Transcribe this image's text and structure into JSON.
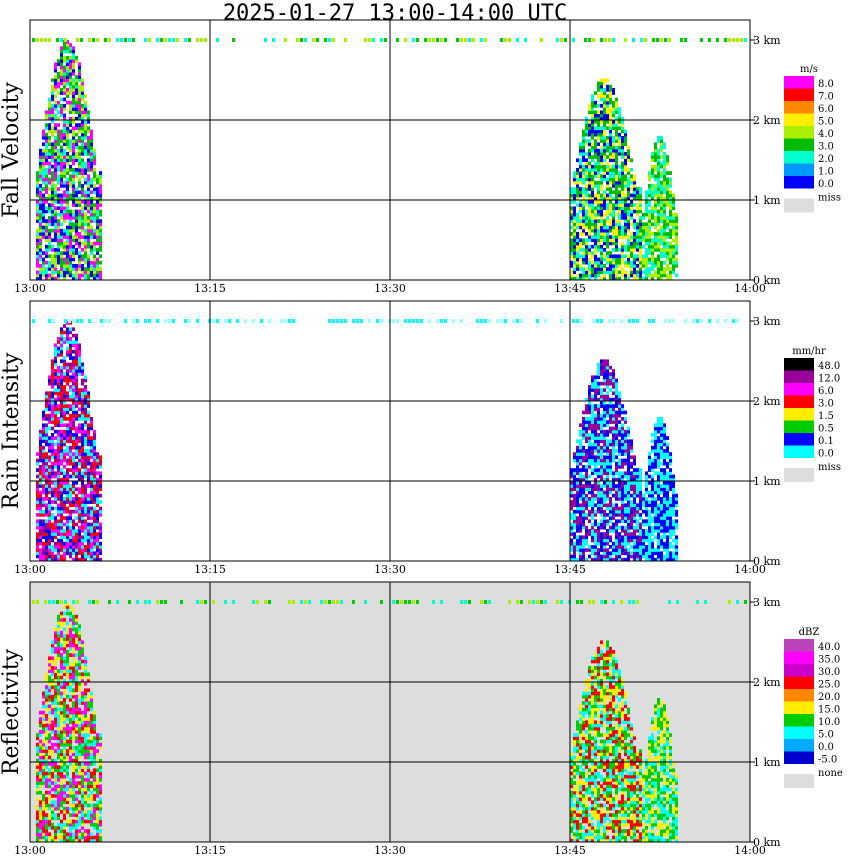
{
  "title": "2025-01-27  13:00-14:00 UTC",
  "x_ticks": [
    "13:00",
    "13:15",
    "13:30",
    "13:45",
    "14:00"
  ],
  "y_ticks": [
    "0 km",
    "1 km",
    "2 km",
    "3 km"
  ],
  "chart_data": [
    {
      "type": "heatmap",
      "ylabel": "Fall Velocity",
      "units": "m/s",
      "background": "#ffffff",
      "x_range": [
        "13:00",
        "14:00"
      ],
      "y_range_km": [
        0,
        3
      ],
      "colorbar": {
        "labels": [
          "8.0",
          "7.0",
          "6.0",
          "5.0",
          "4.0",
          "3.0",
          "2.0",
          "1.0",
          "0.0"
        ],
        "colors": [
          "#ff00ff",
          "#ff0000",
          "#ff8800",
          "#ffee00",
          "#aaee00",
          "#00bb00",
          "#00ffcc",
          "#0099ff",
          "#0000ff"
        ],
        "missing_label": "miss",
        "missing_color": "#dddddd"
      },
      "echoes": [
        {
          "t_start_min": 0.5,
          "t_end_min": 6,
          "z_top_km": 3.0,
          "colors": [
            "#00bb00",
            "#0000ff",
            "#00ffcc",
            "#ff00ff",
            "#aaee00"
          ]
        },
        {
          "t_start_min": 45,
          "t_end_min": 51,
          "z_top_km": 2.5,
          "colors": [
            "#00bb00",
            "#0000ff",
            "#ffee00",
            "#00ffcc"
          ]
        },
        {
          "t_start_min": 51,
          "t_end_min": 54,
          "z_top_km": 1.8,
          "colors": [
            "#00bb00",
            "#00ffcc",
            "#aaee00"
          ]
        }
      ]
    },
    {
      "type": "heatmap",
      "ylabel": "Rain Intensity",
      "units": "mm/hr",
      "background": "#ffffff",
      "x_range": [
        "13:00",
        "14:00"
      ],
      "y_range_km": [
        0,
        3
      ],
      "colorbar": {
        "labels": [
          "48.0",
          "12.0",
          "6.0",
          "3.0",
          "1.5",
          "0.5",
          "0.1",
          "0.0"
        ],
        "colors": [
          "#000000",
          "#990099",
          "#ff00ff",
          "#ff0000",
          "#ffee00",
          "#00cc00",
          "#0000ff",
          "#00ffff"
        ],
        "missing_label": "miss",
        "missing_color": "#dddddd"
      },
      "echoes": [
        {
          "t_start_min": 0.5,
          "t_end_min": 6,
          "z_top_km": 3.0,
          "colors": [
            "#ff00ff",
            "#ff0000",
            "#990099",
            "#00ffff",
            "#0000ff"
          ]
        },
        {
          "t_start_min": 45,
          "t_end_min": 51,
          "z_top_km": 2.5,
          "colors": [
            "#00ffff",
            "#0000ff",
            "#990099"
          ]
        },
        {
          "t_start_min": 51,
          "t_end_min": 54,
          "z_top_km": 1.8,
          "colors": [
            "#00ffff",
            "#0000ff"
          ]
        }
      ]
    },
    {
      "type": "heatmap",
      "ylabel": "Reflectivity",
      "units": "dBZ",
      "background": "#dddddd",
      "x_range": [
        "13:00",
        "14:00"
      ],
      "y_range_km": [
        0,
        3
      ],
      "colorbar": {
        "labels": [
          "40.0",
          "35.0",
          "30.0",
          "25.0",
          "20.0",
          "15.0",
          "10.0",
          "5.0",
          "0.0",
          "-5.0"
        ],
        "colors": [
          "#bb44bb",
          "#ff00ff",
          "#cc00cc",
          "#ff0000",
          "#ff8800",
          "#ffee00",
          "#00cc00",
          "#00ffff",
          "#00aaff",
          "#0000cc"
        ],
        "missing_label": "none",
        "missing_color": "#dddddd"
      },
      "echoes": [
        {
          "t_start_min": 0.5,
          "t_end_min": 6,
          "z_top_km": 3.0,
          "colors": [
            "#ff0000",
            "#ffee00",
            "#00cc00",
            "#ff00ff",
            "#00ffff"
          ]
        },
        {
          "t_start_min": 45,
          "t_end_min": 51,
          "z_top_km": 2.5,
          "colors": [
            "#00ffff",
            "#ff0000",
            "#00cc00",
            "#ffee00"
          ]
        },
        {
          "t_start_min": 51,
          "t_end_min": 54,
          "z_top_km": 1.8,
          "colors": [
            "#00cc00",
            "#00ffff",
            "#ffee00"
          ]
        }
      ]
    }
  ]
}
